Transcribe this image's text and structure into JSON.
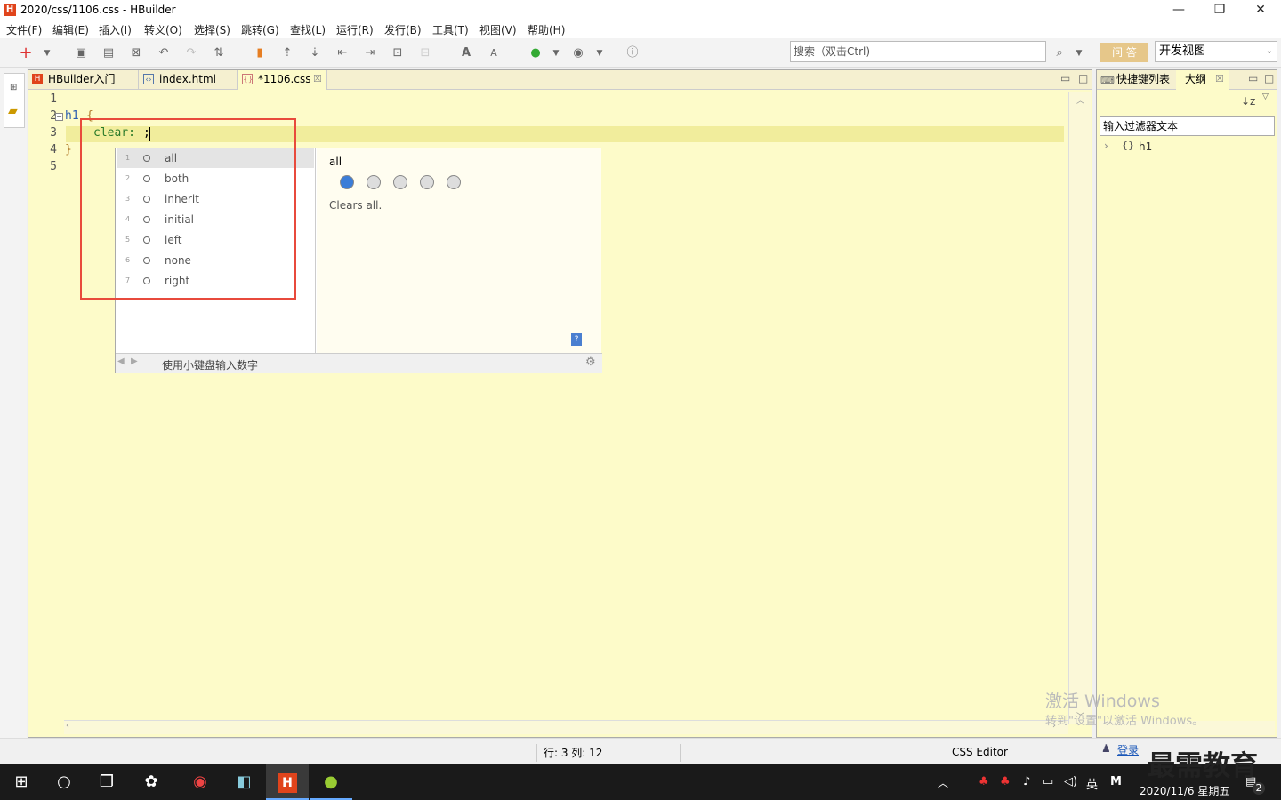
{
  "window": {
    "title": "2020/css/1106.css  -  HBuilder",
    "app_icon": "H"
  },
  "menu": [
    "文件(F)",
    "编辑(E)",
    "插入(I)",
    "转义(O)",
    "选择(S)",
    "跳转(G)",
    "查找(L)",
    "运行(R)",
    "发行(B)",
    "工具(T)",
    "视图(V)",
    "帮助(H)"
  ],
  "search": {
    "placeholder": "搜索（双击Ctrl)"
  },
  "toolbar_right": {
    "wenda": "问 答",
    "perspective": "开发视图"
  },
  "editor_tabs": [
    {
      "label": "HBuilder入门"
    },
    {
      "label": "index.html"
    },
    {
      "label": "*1106.css"
    }
  ],
  "code": {
    "line_numbers": [
      "1",
      "2",
      "3",
      "4",
      "5"
    ],
    "selector": "h1",
    "open_brace": "{",
    "property": "clear:",
    "value": ";",
    "close_brace": "}"
  },
  "autocomplete": {
    "items": [
      {
        "num": "1",
        "label": "all"
      },
      {
        "num": "2",
        "label": "both"
      },
      {
        "num": "3",
        "label": "inherit"
      },
      {
        "num": "4",
        "label": "initial"
      },
      {
        "num": "5",
        "label": "left"
      },
      {
        "num": "6",
        "label": "none"
      },
      {
        "num": "7",
        "label": "right"
      }
    ],
    "doc_title": "all",
    "doc_text": "Clears all.",
    "footer": "使用小键盘输入数字"
  },
  "right_panel": {
    "tab1": "快捷键列表",
    "tab2": "大纲",
    "filter": "输入过滤器文本",
    "outline_item": "h1",
    "login": "登录"
  },
  "status": {
    "position": "行: 3 列: 12",
    "mode": "CSS Editor"
  },
  "watermark": {
    "line1": "激活 Windows",
    "line2": "转到\"设置\"以激活 Windows。"
  },
  "tray": {
    "ime": "英",
    "date": "2020/11/6 星期五",
    "notif_count": "2"
  },
  "brand": "最需教育"
}
